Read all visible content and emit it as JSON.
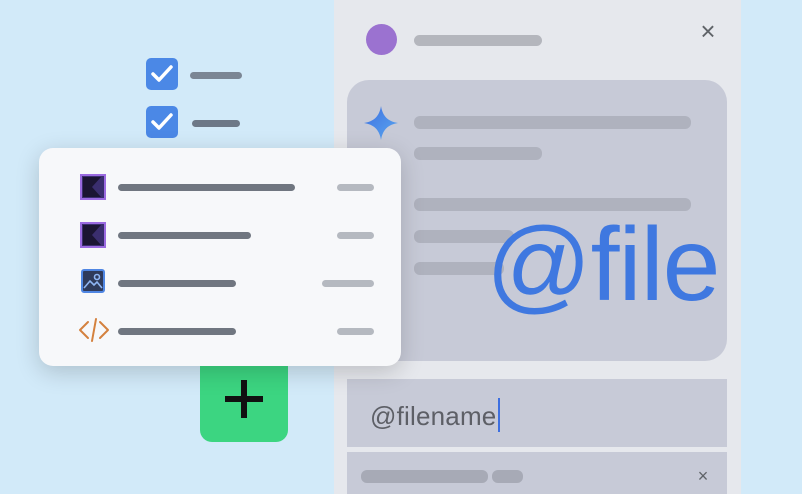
{
  "chat": {
    "input_value": "@filename",
    "close_symbol": "×"
  },
  "overlay": {
    "mention_text": "@file"
  },
  "icons": {
    "avatar": "avatar",
    "spark": "sparkle-icon",
    "close": "close-icon",
    "kotlin": "kotlin-file-icon",
    "image": "image-file-icon",
    "code": "code-file-icon",
    "check": "checkbox-checked-icon",
    "add": "plus-icon"
  },
  "colors": {
    "background": "#d2eaf9",
    "panel": "#e6e8ed",
    "bubble": "#c7cad7",
    "accent_blue": "#3f78e0",
    "add_button": "#3cd581",
    "avatar": "#9b72d0"
  },
  "checklist": [
    {
      "checked": true
    },
    {
      "checked": true
    }
  ],
  "file_list": [
    {
      "type": "kotlin"
    },
    {
      "type": "kotlin"
    },
    {
      "type": "image"
    },
    {
      "type": "code"
    }
  ]
}
